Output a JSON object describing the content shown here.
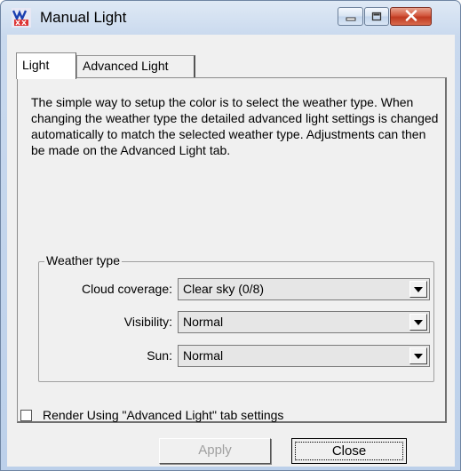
{
  "window": {
    "title": "Manual Light",
    "app_icon": "wind-app-icon",
    "controls": {
      "minimize": "minimize-icon",
      "maximize": "maximize-icon",
      "close": "close-icon"
    }
  },
  "tabs": [
    {
      "label": "Light",
      "selected": true
    },
    {
      "label": "Advanced Light",
      "selected": false
    }
  ],
  "light_tab": {
    "description": "The simple way to setup the color is to select the weather type. When changing the weather type the detailed advanced light settings is changed automatically to match the selected weather type. Adjustments can then be made on the Advanced Light tab.",
    "weather_group": {
      "title": "Weather type",
      "fields": [
        {
          "label": "Cloud coverage:",
          "value": "Clear sky (0/8)"
        },
        {
          "label": "Visibility:",
          "value": "Normal"
        },
        {
          "label": "Sun:",
          "value": "Normal"
        }
      ]
    }
  },
  "render_checkbox": {
    "label": "Render Using \"Advanced Light\" tab settings",
    "checked": false
  },
  "buttons": {
    "apply": "Apply",
    "close": "Close"
  },
  "colors": {
    "dialog_bg": "#f0f0f0",
    "close_button": "#c9452c",
    "disabled_text": "#a0a0a0"
  }
}
